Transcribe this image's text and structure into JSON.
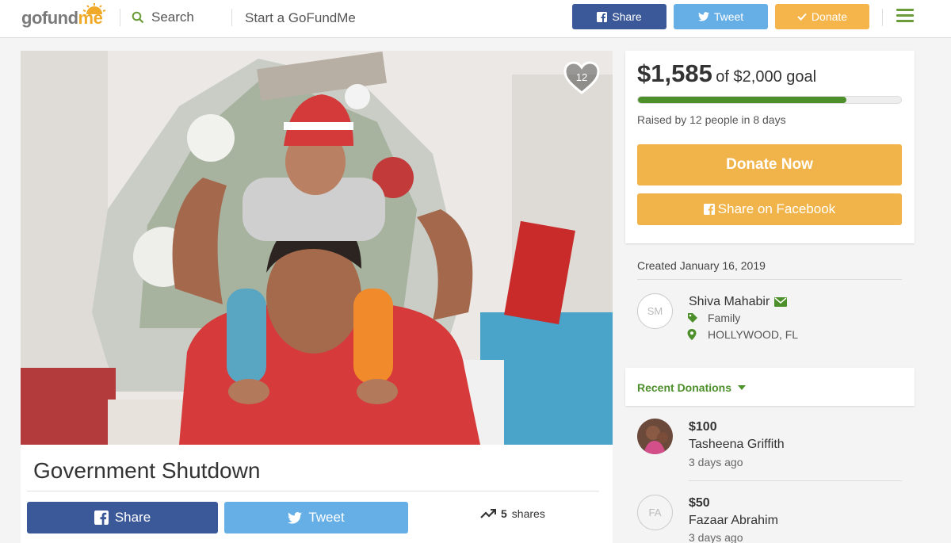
{
  "header": {
    "logo": "gofundme",
    "logo_part1": "gofund",
    "logo_part2": "me",
    "search_label": "Search",
    "start_label": "Start a GoFundMe",
    "share_label": "Share",
    "tweet_label": "Tweet",
    "donate_label": "Donate"
  },
  "campaign": {
    "title": "Government Shutdown",
    "heart_count": "12",
    "share_label": "Share",
    "tweet_label": "Tweet",
    "shares_count": "5",
    "shares_word": "shares"
  },
  "funding": {
    "raised": "$1,585",
    "goal_text": "of $2,000 goal",
    "progress": 0.7925,
    "raised_by": "Raised by 12 people in 8 days",
    "donate_now": "Donate Now",
    "share_facebook": "Share on Facebook"
  },
  "organizer": {
    "created": "Created January 16, 2019",
    "initials": "SM",
    "name": "Shiva Mahabir",
    "category": "Family",
    "location": "HOLLYWOOD, FL"
  },
  "recent": {
    "label": "Recent Donations",
    "donations": [
      {
        "amount": "$100",
        "name": "Tasheena Griffith",
        "time": "3 days ago"
      },
      {
        "amount": "$50",
        "name": "Fazaar Abrahim",
        "time": "3 days ago",
        "initials": "FA"
      }
    ]
  },
  "colors": {
    "brand_green": "#4d8f2b",
    "donate_orange": "#f1b44a",
    "facebook_blue": "#3b5998",
    "twitter_blue": "#65aee6"
  }
}
